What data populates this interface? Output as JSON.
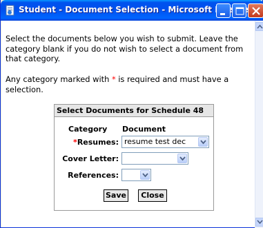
{
  "window": {
    "title": "Student - Document Selection - Microsoft Internet..."
  },
  "content": {
    "intro": "Select the documents below you wish to submit.  Leave the category blank if you do not wish to select a document from that category.",
    "required_before": "Any category marked with ",
    "required_star": "*",
    "required_after": " is required and must have a selection."
  },
  "panel": {
    "title": "Select Documents for Schedule 48",
    "col_category": "Category",
    "col_document": "Document",
    "rows": [
      {
        "star": "*",
        "label": "Resumes:",
        "value": "resume test dec"
      },
      {
        "star": "",
        "label": "Cover Letter:",
        "value": ""
      },
      {
        "star": "",
        "label": "References:",
        "value": ""
      }
    ],
    "save_label": "Save",
    "close_label": "Close"
  },
  "icons": {
    "window_icon": "ie-page-icon",
    "minimize": "minimize-icon",
    "maximize": "maximize-icon",
    "close": "close-icon",
    "dropdown": "chevron-down-icon"
  },
  "colors": {
    "titlebar": "#0053ee",
    "required": "#ff0000",
    "panel_header": "#e6e6e6"
  }
}
